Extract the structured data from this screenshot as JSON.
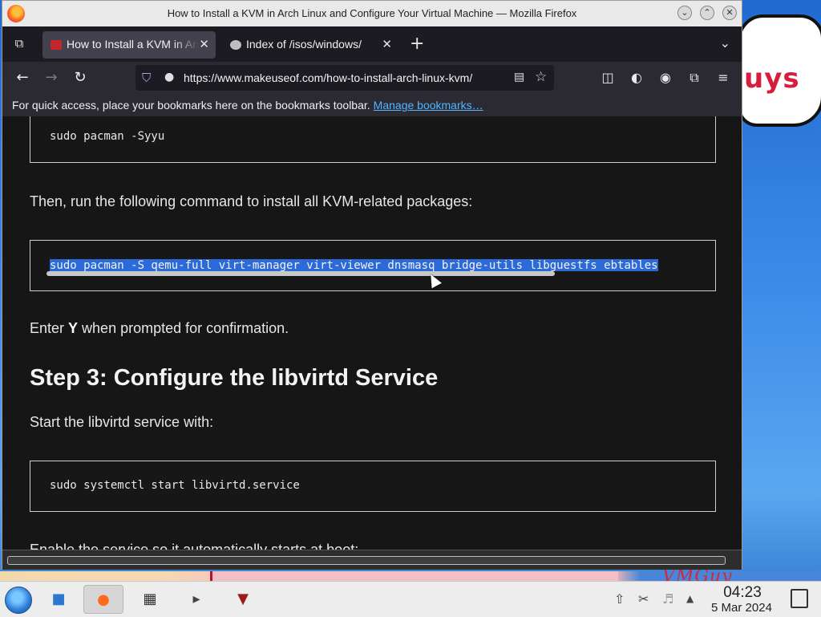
{
  "window": {
    "title": "How to Install a KVM in Arch Linux and Configure Your Virtual Machine — Mozilla Firefox",
    "minimize_glyph": "⌄",
    "maximize_glyph": "⌃",
    "close_glyph": "✕"
  },
  "tabs": [
    {
      "label": "How to Install a KVM in Arch Linux and Configure Your Virtual Machine",
      "active": true,
      "favicon": "muo-favicon",
      "close_glyph": "✕"
    },
    {
      "label": "Index of /isos/windows/",
      "active": false,
      "favicon": "folder-favicon",
      "close_glyph": "✕"
    }
  ],
  "tabbar": {
    "new_tab_glyph": "+",
    "overflow_glyph": "⌄",
    "tab_list_glyph": "⧉"
  },
  "nav": {
    "back_glyph": "←",
    "forward_glyph": "→",
    "reload_glyph": "↻",
    "url": "https://www.makeuseof.com/how-to-install-arch-linux-kvm/",
    "shield_glyph": "⛉",
    "lock_glyph": "🔒",
    "reader_glyph": "▤",
    "star_glyph": "☆",
    "pocket_glyph": "◫",
    "sync_glyph": "◐",
    "account_glyph": "◉",
    "extensions_glyph": "⧉",
    "menu_glyph": "≡"
  },
  "bookmarks_toolbar": {
    "message": "For quick access, place your bookmarks here on the bookmarks toolbar.",
    "link": "Manage bookmarks…"
  },
  "article": {
    "code1": "sudo pacman -Syyu",
    "para1": "Then, run the following command to install all KVM-related packages:",
    "code2": "sudo pacman -S qemu-full virt-manager virt-viewer dnsmasq bridge-utils libguestfs ebtables",
    "para2_prefix": "Enter ",
    "para2_bold": "Y",
    "para2_suffix": " when prompted for confirmation.",
    "heading": "Step 3: Configure the libvirtd Service",
    "para3": "Start the libvirtd service with:",
    "code3": "sudo systemctl start libvirtd.service",
    "para4": "Enable the service so it automatically starts at boot:"
  },
  "wallpaper": {
    "bubble_text": "uys",
    "signature": "VMGuy"
  },
  "taskbar": {
    "clock_time": "04:23",
    "clock_date": "5 Mar 2024",
    "apps": [
      "file-manager",
      "firefox",
      "terminal",
      "terminal-2",
      "wine"
    ]
  }
}
